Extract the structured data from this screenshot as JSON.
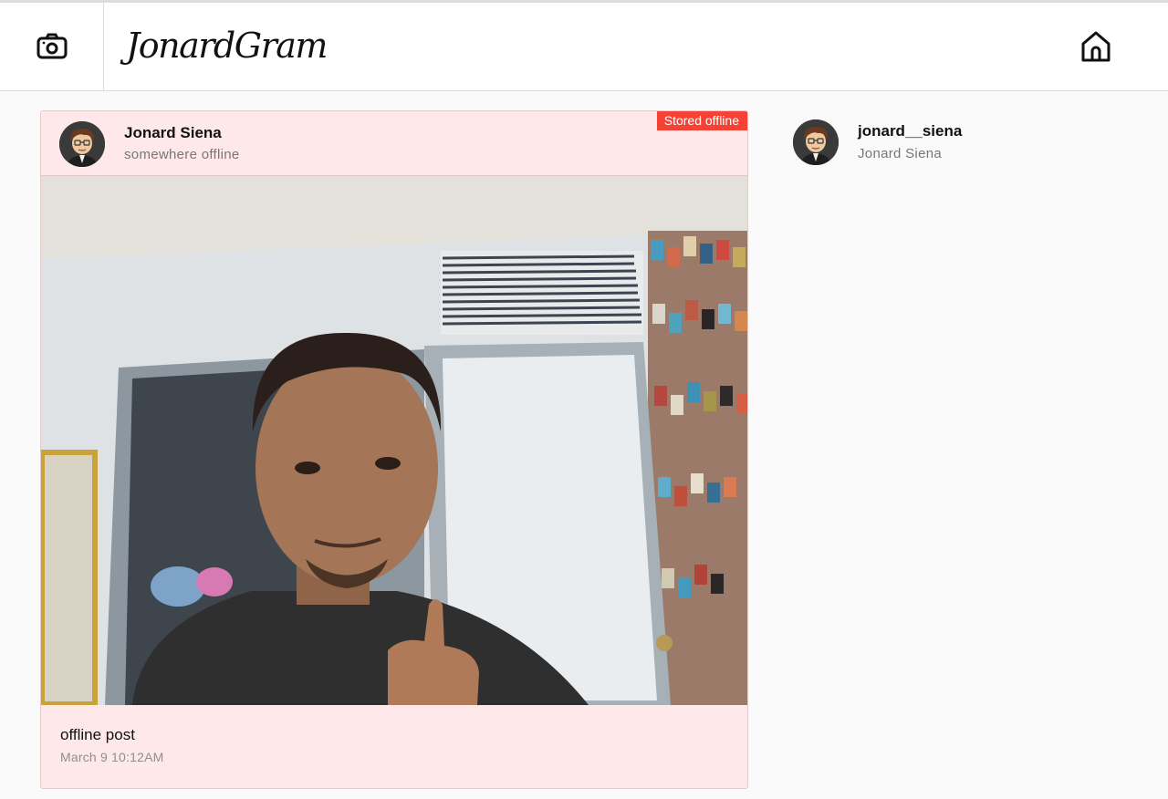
{
  "app": {
    "logo_text": "JonardGram"
  },
  "header": {
    "camera_icon": "camera-icon",
    "home_icon": "home-icon"
  },
  "post": {
    "badge": "Stored offline",
    "author_name": "Jonard Siena",
    "location": "somewhere offline",
    "caption": "offline post",
    "timestamp": "March 9 10:12AM",
    "badge_color": "#f44336",
    "card_color": "#ffe8ea"
  },
  "sidebar": {
    "username": "jonard__siena",
    "full_name": "Jonard Siena"
  }
}
